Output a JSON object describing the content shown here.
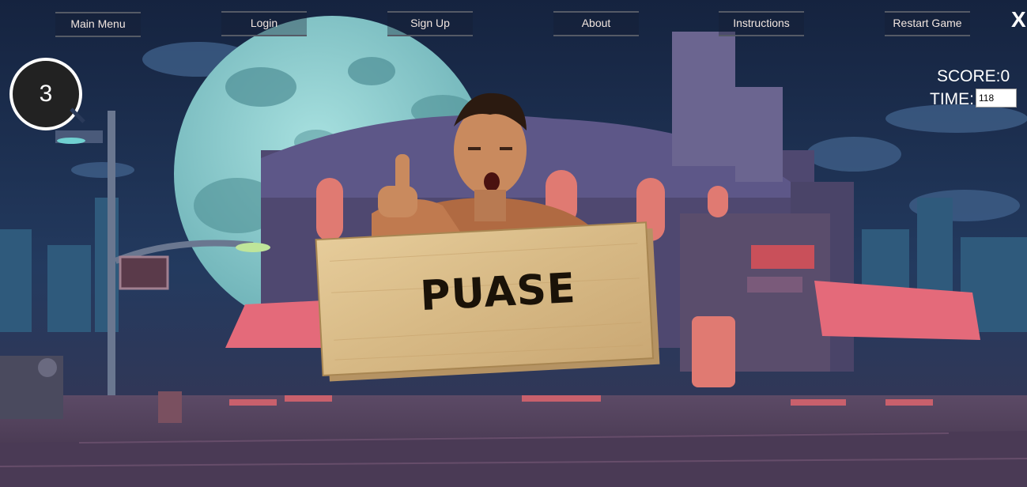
{
  "nav": {
    "items": [
      {
        "label": "Main Menu"
      },
      {
        "label": "Login"
      },
      {
        "label": "Sign Up"
      },
      {
        "label": "About"
      },
      {
        "label": "Instructions"
      },
      {
        "label": "Restart Game"
      }
    ],
    "close_label": "X"
  },
  "hud": {
    "countdown": "3",
    "score_text": "SCORE:0",
    "time_label": "TIME:",
    "time_value": "118"
  },
  "sign": {
    "text": "PUASE"
  },
  "colors": {
    "sky": "#1b2a4a",
    "moon": "#8fcfd0",
    "awning": "#e46a7a",
    "sign_wood": "#dcc08e",
    "sign_text": "#1a1208"
  }
}
